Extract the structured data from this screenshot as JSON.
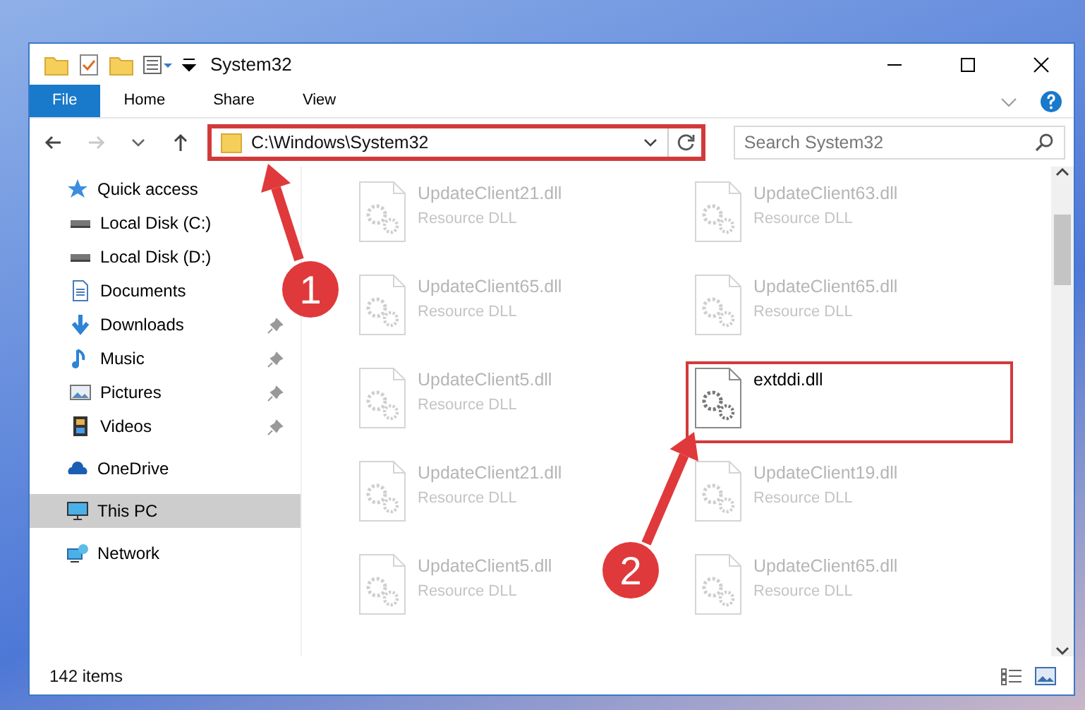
{
  "window": {
    "title": "System32"
  },
  "ribbon_tabs": [
    {
      "label": "File",
      "kind": "file"
    },
    {
      "label": "Home",
      "kind": "tab"
    },
    {
      "label": "Share",
      "kind": "tab"
    },
    {
      "label": "View",
      "kind": "tab"
    }
  ],
  "address": {
    "path": "C:\\Windows\\System32",
    "highlighted": true
  },
  "search": {
    "placeholder": "Search System32"
  },
  "sidebar": {
    "items": [
      {
        "label": "Quick access",
        "kind": "star",
        "selected": false,
        "children": [
          {
            "label": "Local Disk (C:)",
            "kind": "drive",
            "pinned": false
          },
          {
            "label": "Local Disk (D:)",
            "kind": "drive",
            "pinned": false
          },
          {
            "label": "Documents",
            "kind": "document",
            "pinned": false
          },
          {
            "label": "Downloads",
            "kind": "download",
            "pinned": true
          },
          {
            "label": "Music",
            "kind": "music",
            "pinned": true
          },
          {
            "label": "Pictures",
            "kind": "picture",
            "pinned": true
          },
          {
            "label": "Videos",
            "kind": "film",
            "pinned": true
          }
        ]
      },
      {
        "label": "OneDrive",
        "kind": "cloud",
        "selected": false
      },
      {
        "label": "This PC",
        "kind": "computer",
        "selected": true
      },
      {
        "label": "Network",
        "kind": "network",
        "selected": false
      }
    ]
  },
  "files": [
    {
      "name": "UpdateClient21.dll",
      "type": "Resource DLL",
      "faded": true,
      "highlighted": false
    },
    {
      "name": "UpdateClient63.dll",
      "type": "Resource DLL",
      "faded": true,
      "highlighted": false
    },
    {
      "name": "UpdateClient65.dll",
      "type": "Resource DLL",
      "faded": true,
      "highlighted": false
    },
    {
      "name": "UpdateClient65.dll",
      "type": "Resource DLL",
      "faded": true,
      "highlighted": false
    },
    {
      "name": "UpdateClient5.dll",
      "type": "Resource DLL",
      "faded": true,
      "highlighted": false
    },
    {
      "name": "extddi.dll",
      "faded": false,
      "highlighted": true
    },
    {
      "name": "UpdateClient21.dll",
      "type": "Resource DLL",
      "faded": true,
      "highlighted": false
    },
    {
      "name": "UpdateClient19.dll",
      "type": "Resource DLL",
      "faded": true,
      "highlighted": false
    },
    {
      "name": "UpdateClient5.dll",
      "type": "Resource DLL",
      "faded": true,
      "highlighted": false
    },
    {
      "name": "UpdateClient65.dll",
      "type": "Resource DLL",
      "faded": true,
      "highlighted": false
    }
  ],
  "status_bar": {
    "item_count": "142 items"
  },
  "annotations": [
    {
      "number": "1"
    },
    {
      "number": "2"
    }
  ]
}
